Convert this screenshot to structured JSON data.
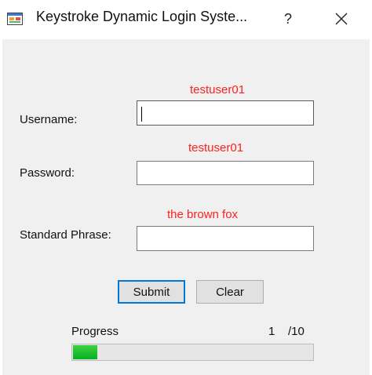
{
  "window": {
    "title": "Keystroke Dynamic Login Syste...",
    "help_label": "?",
    "close_icon": "close-icon",
    "app_icon": "windows-form-icon"
  },
  "form": {
    "username": {
      "label": "Username:",
      "hint": "testuser01",
      "value": ""
    },
    "password": {
      "label": "Password:",
      "hint": "testuser01",
      "value": ""
    },
    "phrase": {
      "label": "Standard Phrase:",
      "hint": "the brown fox",
      "value": ""
    },
    "hint_color": "#ff2020"
  },
  "buttons": {
    "submit_label": "Submit",
    "clear_label": "Clear"
  },
  "progress": {
    "label": "Progress",
    "current": "1",
    "total": "/10",
    "fraction": 0.1,
    "fill_color": "#06b025"
  }
}
